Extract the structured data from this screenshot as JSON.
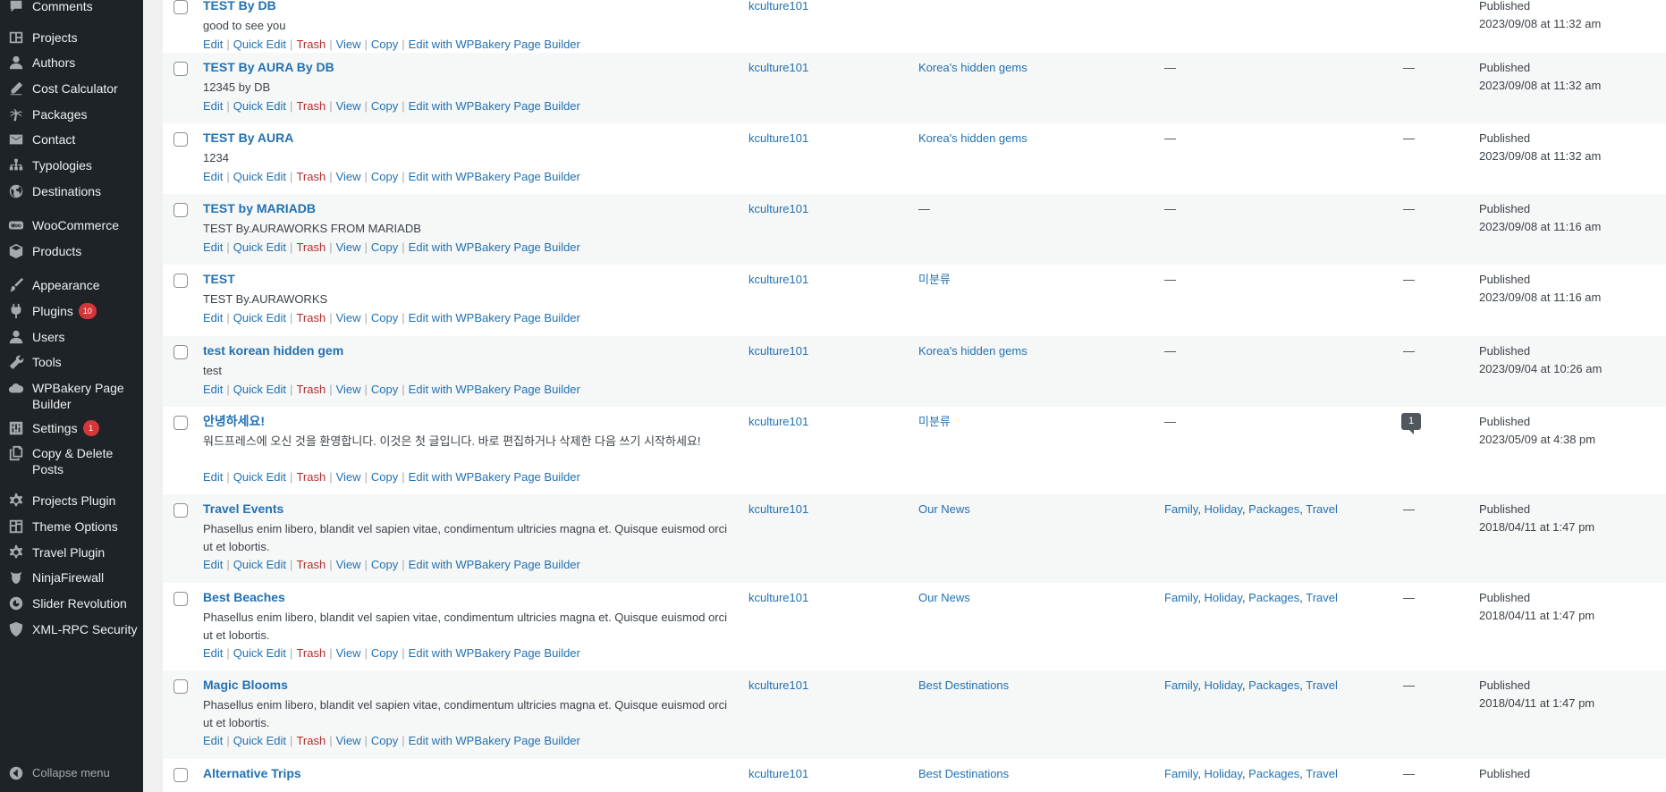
{
  "sidebar": {
    "items": [
      {
        "label": "Comments",
        "icon": "comments-icon"
      },
      {
        "label": "Projects",
        "icon": "projects-icon"
      },
      {
        "label": "Authors",
        "icon": "authors-icon"
      },
      {
        "label": "Cost Calculator",
        "icon": "pencil-icon"
      },
      {
        "label": "Packages",
        "icon": "palm-tree-icon"
      },
      {
        "label": "Contact",
        "icon": "envelope-icon"
      },
      {
        "label": "Typologies",
        "icon": "hierarchy-icon"
      },
      {
        "label": "Destinations",
        "icon": "globe-icon"
      },
      {
        "label": "WooCommerce",
        "icon": "woocommerce-icon"
      },
      {
        "label": "Products",
        "icon": "box-icon"
      },
      {
        "label": "Appearance",
        "icon": "paintbrush-icon"
      },
      {
        "label": "Plugins",
        "icon": "plugins-icon",
        "badge": "10"
      },
      {
        "label": "Users",
        "icon": "users-icon"
      },
      {
        "label": "Tools",
        "icon": "wrench-icon"
      },
      {
        "label": "WPBakery Page Builder",
        "icon": "cloud-icon"
      },
      {
        "label": "Settings",
        "icon": "settings-icon",
        "badge": "1"
      },
      {
        "label": "Copy & Delete Posts",
        "icon": "copy-icon"
      },
      {
        "label": "Projects Plugin",
        "icon": "gear-icon"
      },
      {
        "label": "Theme Options",
        "icon": "dashboard-icon"
      },
      {
        "label": "Travel Plugin",
        "icon": "gear-icon"
      },
      {
        "label": "NinjaFirewall",
        "icon": "ninja-icon"
      },
      {
        "label": "Slider Revolution",
        "icon": "slider-icon"
      },
      {
        "label": "XML-RPC Security",
        "icon": "shield-icon"
      }
    ],
    "collapse_label": "Collapse menu"
  },
  "row_actions": {
    "edit": "Edit",
    "quick_edit": "Quick Edit",
    "trash": "Trash",
    "view": "View",
    "copy": "Copy",
    "wpbakery": "Edit with WPBakery Page Builder",
    "separator": "|"
  },
  "posts": [
    {
      "title": "TEST By DB",
      "excerpt": "good to see you",
      "author": "kculture101",
      "category": "",
      "tags": [],
      "comments": "",
      "status": "Published",
      "date": "2023/09/08 at 11:32 am"
    },
    {
      "title": "TEST By AURA By DB",
      "excerpt": "12345 by DB",
      "author": "kculture101",
      "category": "Korea's hidden gems",
      "tags": [],
      "comments": "—",
      "status": "Published",
      "date": "2023/09/08 at 11:32 am"
    },
    {
      "title": "TEST By AURA",
      "excerpt": "1234",
      "author": "kculture101",
      "category": "Korea's hidden gems",
      "tags": [],
      "comments": "—",
      "status": "Published",
      "date": "2023/09/08 at 11:32 am"
    },
    {
      "title": "TEST by MARIADB",
      "excerpt": "TEST By.AURAWORKS FROM MARIADB",
      "author": "kculture101",
      "category": "—",
      "tags": [],
      "comments": "—",
      "status": "Published",
      "date": "2023/09/08 at 11:16 am"
    },
    {
      "title": "TEST",
      "excerpt": "TEST By.AURAWORKS",
      "author": "kculture101",
      "category": "미분류",
      "tags": [],
      "comments": "—",
      "status": "Published",
      "date": "2023/09/08 at 11:16 am"
    },
    {
      "title": "test korean hidden gem",
      "excerpt": "test",
      "author": "kculture101",
      "category": "Korea's hidden gems",
      "tags": [],
      "comments": "—",
      "status": "Published",
      "date": "2023/09/04 at 10:26 am"
    },
    {
      "title": "안녕하세요!",
      "excerpt": "워드프레스에 오신 것을 환영합니다. 이것은 첫 글입니다. 바로 편집하거나 삭제한 다음 쓰기 시작하세요!",
      "author": "kculture101",
      "category": "미분류",
      "tags": [],
      "comments": "1",
      "status": "Published",
      "date": "2023/05/09 at 4:38 pm"
    },
    {
      "title": "Travel Events",
      "excerpt": "Phasellus enim libero, blandit vel sapien vitae, condimentum ultricies magna et. Quisque euismod orci ut et lobortis.",
      "author": "kculture101",
      "category": "Our News",
      "tags": [
        "Family",
        "Holiday",
        "Packages",
        "Travel"
      ],
      "comments": "—",
      "status": "Published",
      "date": "2018/04/11 at 1:47 pm"
    },
    {
      "title": "Best Beaches",
      "excerpt": "Phasellus enim libero, blandit vel sapien vitae, condimentum ultricies magna et. Quisque euismod orci ut et lobortis.",
      "author": "kculture101",
      "category": "Our News",
      "tags": [
        "Family",
        "Holiday",
        "Packages",
        "Travel"
      ],
      "comments": "—",
      "status": "Published",
      "date": "2018/04/11 at 1:47 pm"
    },
    {
      "title": "Magic Blooms",
      "excerpt": "Phasellus enim libero, blandit vel sapien vitae, condimentum ultricies magna et. Quisque euismod orci ut et lobortis.",
      "author": "kculture101",
      "category": "Best Destinations",
      "tags": [
        "Family",
        "Holiday",
        "Packages",
        "Travel"
      ],
      "comments": "—",
      "status": "Published",
      "date": "2018/04/11 at 1:47 pm"
    },
    {
      "title": "Alternative Trips",
      "excerpt": "",
      "author": "kculture101",
      "category": "Best Destinations",
      "tags": [
        "Family",
        "Holiday",
        "Packages",
        "Travel"
      ],
      "comments": "—",
      "status": "Published",
      "date": ""
    }
  ],
  "tags_empty": "—",
  "tag_separator": ", "
}
